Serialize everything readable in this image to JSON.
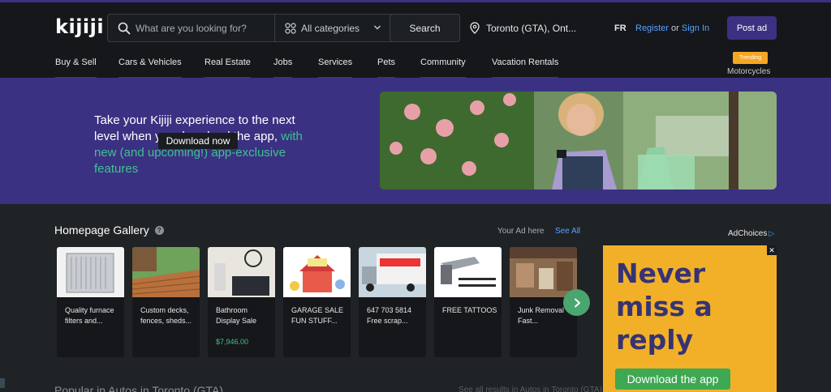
{
  "header": {
    "logo": "kijiji",
    "search": {
      "placeholder": "What are you looking for?",
      "category": "All categories",
      "button": "Search"
    },
    "location": "Toronto (GTA), Ont...",
    "lang": "FR",
    "register": "Register",
    "or": "or",
    "sign_in": "Sign In",
    "post_ad": "Post ad"
  },
  "nav": {
    "items": [
      "Buy & Sell",
      "Cars & Vehicles",
      "Real Estate",
      "Jobs",
      "Services",
      "Pets",
      "Community",
      "Vacation Rentals"
    ],
    "trending_badge": "Trending",
    "trending_link": "Motorcycles"
  },
  "banner": {
    "text_white": "Take your Kijiji experience to the next level when you download the app,",
    "text_green": "with new (and upcoming!) app-exclusive features",
    "download_button": "Download now"
  },
  "gallery": {
    "title": "Homepage Gallery",
    "help_glyph": "?",
    "your_ad_here": "Your Ad here",
    "see_all": "See All",
    "cards": [
      {
        "title": "Quality furnace filters and...",
        "price": ""
      },
      {
        "title": "Custom decks, fences, sheds...",
        "price": ""
      },
      {
        "title": "Bathroom Display Sale",
        "price": "$7,946.00"
      },
      {
        "title": "GARAGE SALE FUN STUFF...",
        "price": ""
      },
      {
        "title": "647 703 5814 Free scrap...",
        "price": ""
      },
      {
        "title": "FREE TATTOOS",
        "price": ""
      },
      {
        "title": "Junk Removal Fast...",
        "price": ""
      }
    ]
  },
  "ad": {
    "adchoices": "AdChoices",
    "headline": "Never miss a reply",
    "button": "Download the app",
    "close_glyph": "✕"
  },
  "sections": {
    "popular_title": "Popular in Autos in Toronto (GTA)",
    "popular_right": "See all results in Autos in Toronto (GTA)"
  },
  "colors": {
    "accent_purple": "#3b3182",
    "link_blue": "#5aa2ff",
    "green": "#3ec28f",
    "trending_orange": "#f5a623",
    "ad_yellow": "#f2b028"
  }
}
